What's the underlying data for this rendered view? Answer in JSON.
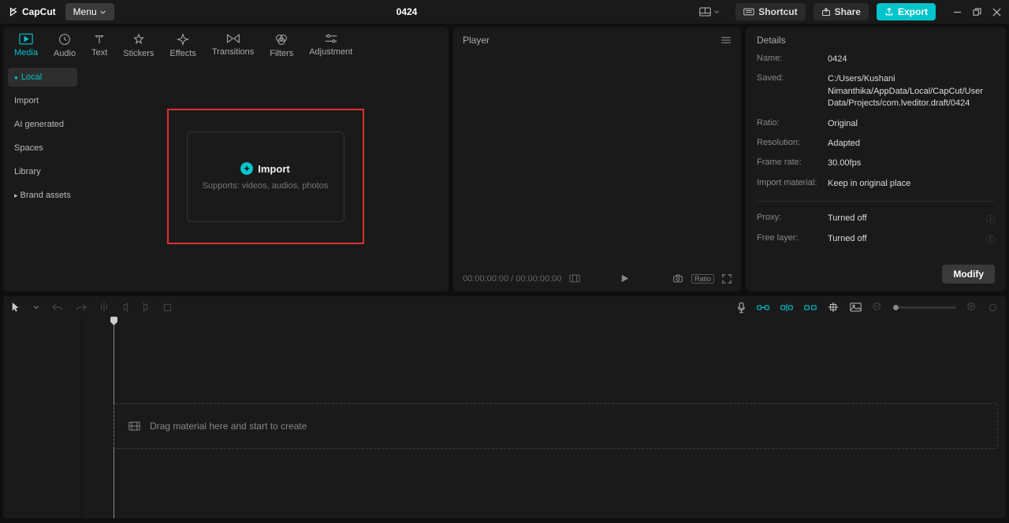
{
  "app": {
    "name": "CapCut"
  },
  "titlebar": {
    "menu": "Menu",
    "project": "0424",
    "shortcut": "Shortcut",
    "share": "Share",
    "export": "Export"
  },
  "topTabs": [
    {
      "label": "Media",
      "active": true
    },
    {
      "label": "Audio"
    },
    {
      "label": "Text"
    },
    {
      "label": "Stickers"
    },
    {
      "label": "Effects"
    },
    {
      "label": "Transitions"
    },
    {
      "label": "Filters"
    },
    {
      "label": "Adjustment"
    }
  ],
  "sideCats": [
    {
      "label": "Local",
      "active": true,
      "marker": "bullet"
    },
    {
      "label": "Import"
    },
    {
      "label": "AI generated"
    },
    {
      "label": "Spaces"
    },
    {
      "label": "Library"
    },
    {
      "label": "Brand assets",
      "marker": "chev"
    }
  ],
  "importBox": {
    "title": "Import",
    "sub": "Supports: videos, audios, photos"
  },
  "player": {
    "title": "Player",
    "time": "00:00:00:00 / 00:00:00:00",
    "ratio": "Ratio"
  },
  "details": {
    "title": "Details",
    "rows": {
      "name": {
        "label": "Name:",
        "value": "0424"
      },
      "saved": {
        "label": "Saved:",
        "value": "C:/Users/Kushani Nimanthika/AppData/Local/CapCut/User Data/Projects/com.lveditor.draft/0424"
      },
      "ratio": {
        "label": "Ratio:",
        "value": "Original"
      },
      "resolution": {
        "label": "Resolution:",
        "value": "Adapted"
      },
      "framerate": {
        "label": "Frame rate:",
        "value": "30.00fps"
      },
      "importmat": {
        "label": "Import material:",
        "value": "Keep in original place"
      },
      "proxy": {
        "label": "Proxy:",
        "value": "Turned off"
      },
      "freelayer": {
        "label": "Free layer:",
        "value": "Turned off"
      }
    },
    "modify": "Modify"
  },
  "timeline": {
    "dropHint": "Drag material here and start to create"
  }
}
